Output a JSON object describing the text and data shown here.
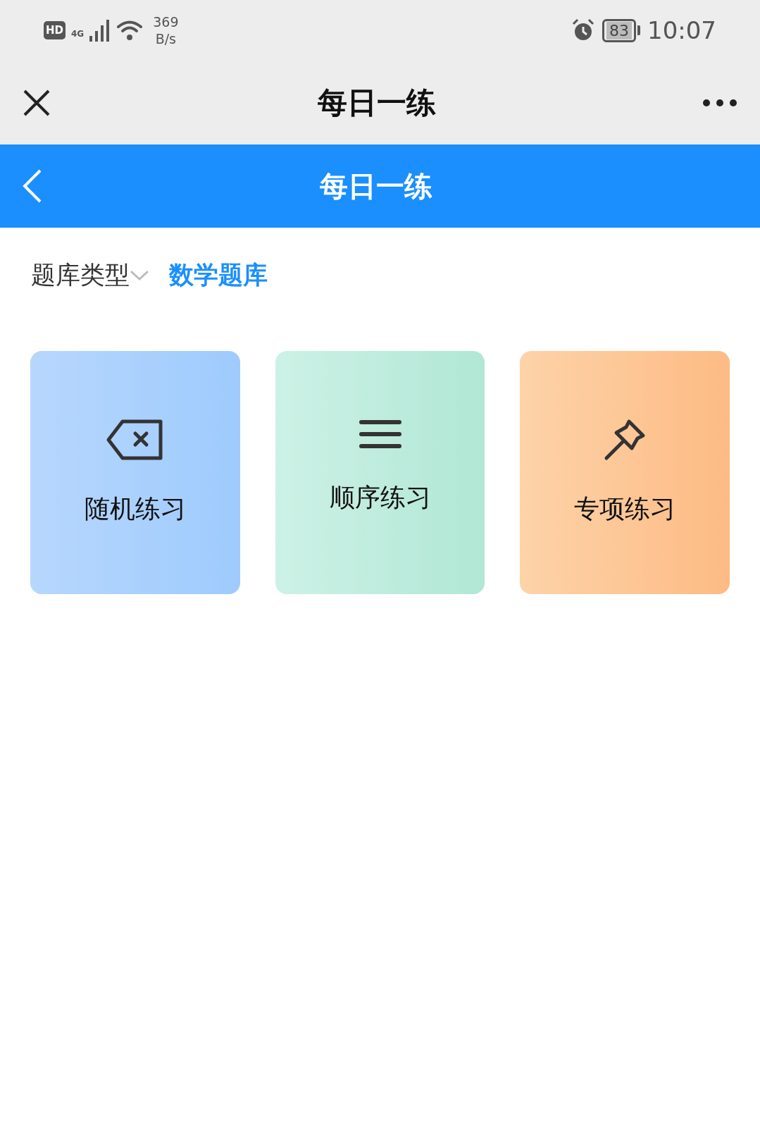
{
  "status_bar": {
    "hd": "HD",
    "network": "4G",
    "speed_value": "369",
    "speed_unit": "B/s",
    "battery": "83",
    "time": "10:07"
  },
  "app_header": {
    "title": "每日一练"
  },
  "page_header": {
    "title": "每日一练"
  },
  "filter": {
    "label": "题库类型",
    "value": "数学题库"
  },
  "cards": [
    {
      "kind": "backspace",
      "label": "随机练习"
    },
    {
      "kind": "list",
      "label": "顺序练习"
    },
    {
      "kind": "pin",
      "label": "专项练习"
    }
  ]
}
